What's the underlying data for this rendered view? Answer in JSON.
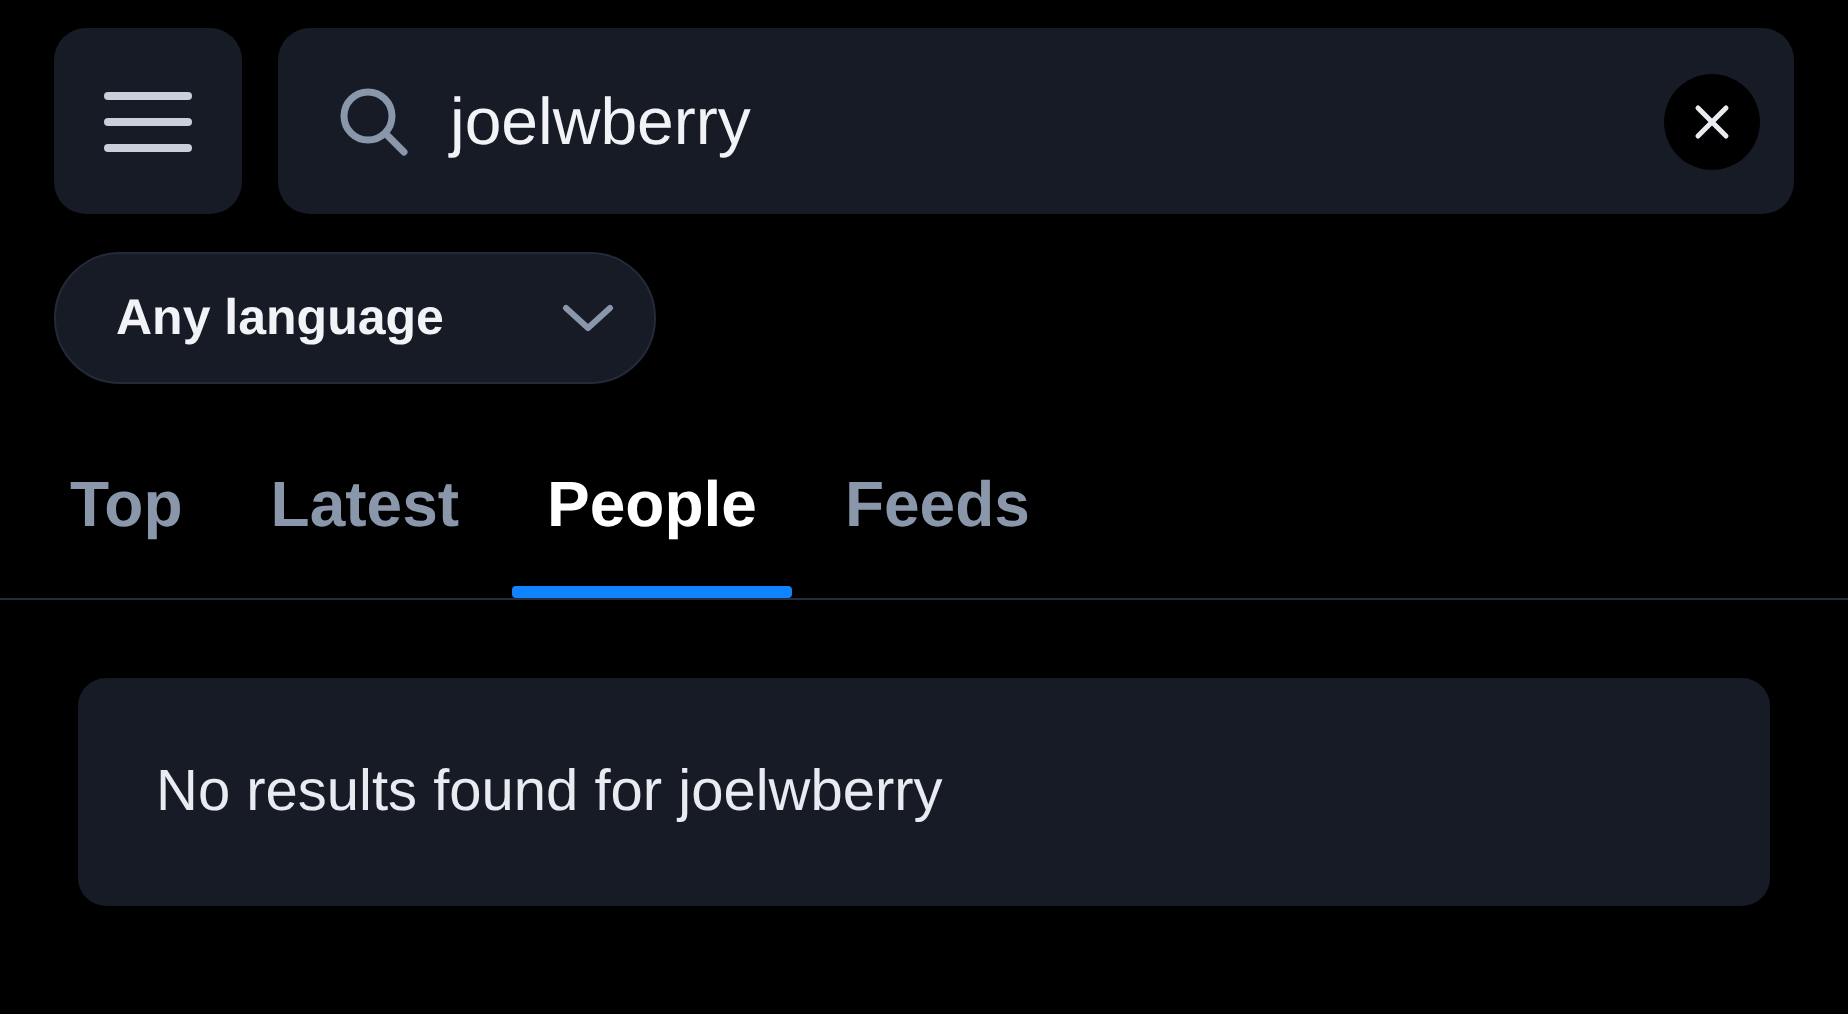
{
  "search": {
    "value": "joelwberry"
  },
  "language_filter": {
    "label": "Any language"
  },
  "tabs": [
    {
      "label": "Top",
      "selected": false
    },
    {
      "label": "Latest",
      "selected": false
    },
    {
      "label": "People",
      "selected": true
    },
    {
      "label": "Feeds",
      "selected": false
    }
  ],
  "results": {
    "message": "No results found for joelwberry"
  }
}
